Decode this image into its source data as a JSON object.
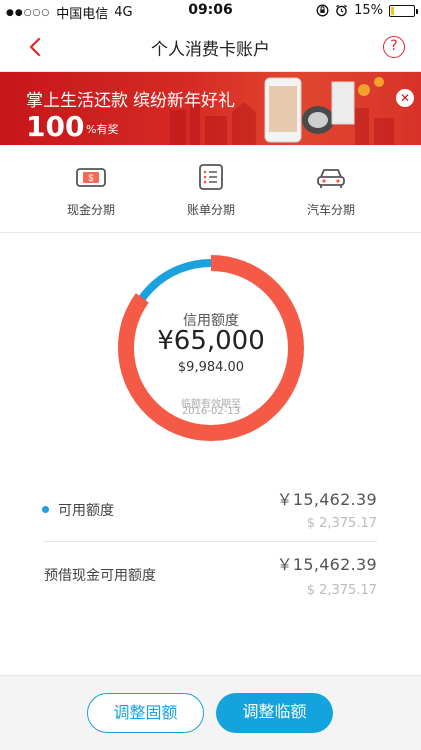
{
  "status_bar": {
    "signal": "●●○○○",
    "carrier": "中国电信",
    "network": "4G",
    "time": "09:06",
    "battery": "15%",
    "battery_level": 0.15
  },
  "nav": {
    "title": "个人消费卡账户",
    "help": "?"
  },
  "banner": {
    "text1": "掌上生活还款",
    "text2": "缤纷新年好礼",
    "number": "100",
    "prize": "%有奖",
    "close": "✕"
  },
  "quick_menu": {
    "items": [
      {
        "label": "现金分期",
        "icon": "cash-icon"
      },
      {
        "label": "账单分期",
        "icon": "bill-icon"
      },
      {
        "label": "汽车分期",
        "icon": "car-icon"
      }
    ]
  },
  "credit": {
    "label": "信用额度",
    "amount": "¥65,000",
    "temp_amount": "$9,984.00",
    "note1": "临额有效期至",
    "note2": "2016-02-13",
    "ring_used_fraction": 0.85,
    "used_color": "#f45a45",
    "available_color": "#1aa1de"
  },
  "rows": [
    {
      "label": "可用额度",
      "value": "￥15,462.39",
      "sub": "$ 2,375.17"
    },
    {
      "label": "预借现金可用额度",
      "value": "￥15,462.39",
      "sub": "$ 2,375.17"
    }
  ],
  "buttons": {
    "fixed": "调整固额",
    "temp": "调整临额"
  },
  "colors": {
    "accent": "#1aa1de",
    "brand_red": "#e0262b"
  }
}
